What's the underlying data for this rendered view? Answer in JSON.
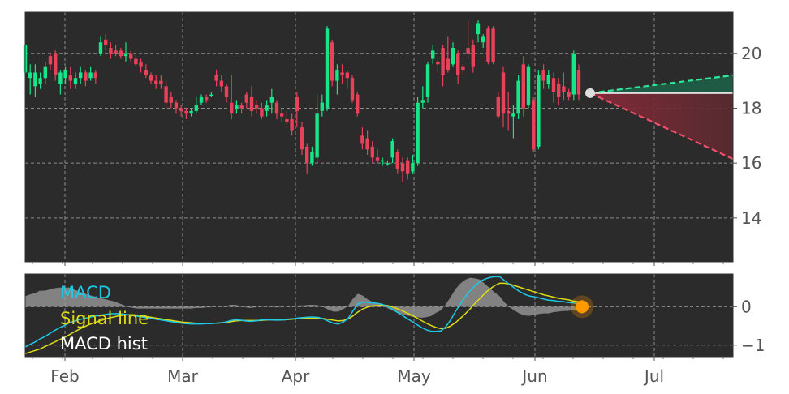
{
  "chart_data": [
    {
      "type": "candlestick",
      "title": "",
      "ylim": [
        12.4,
        21.5
      ],
      "y_ticks": [
        14,
        16,
        18,
        20
      ],
      "grid": true,
      "x_ticks": [
        "Feb",
        "Mar",
        "Apr",
        "May",
        "Jun",
        "Jul"
      ],
      "candles": [
        [
          19.3,
          20.3,
          19.8,
          19.2
        ],
        [
          19.1,
          19.3,
          19.6,
          18.5
        ],
        [
          18.8,
          19.3,
          19.6,
          18.4
        ],
        [
          18.9,
          19.1,
          19.3,
          18.7
        ],
        [
          19.1,
          19.5,
          19.7,
          18.9
        ],
        [
          19.9,
          19.6,
          20.0,
          19.4
        ],
        [
          20.0,
          19.2,
          20.1,
          19.0
        ],
        [
          18.9,
          19.3,
          19.4,
          18.5
        ],
        [
          19.1,
          19.4,
          19.5,
          18.9
        ],
        [
          19.2,
          19.0,
          19.5,
          18.7
        ],
        [
          18.9,
          19.1,
          19.3,
          18.7
        ],
        [
          19.1,
          19.3,
          19.5,
          18.9
        ],
        [
          19.3,
          19.0,
          19.4,
          18.8
        ],
        [
          19.1,
          19.3,
          19.5,
          19.0
        ],
        [
          19.3,
          19.1,
          19.4,
          18.9
        ],
        [
          20.0,
          20.4,
          20.6,
          19.9
        ],
        [
          20.5,
          20.3,
          20.7,
          20.1
        ],
        [
          20.2,
          20.0,
          20.4,
          19.8
        ],
        [
          20.1,
          20.0,
          20.3,
          19.9
        ],
        [
          20.1,
          19.9,
          20.2,
          19.8
        ],
        [
          19.9,
          20.0,
          20.4,
          19.7
        ],
        [
          20.0,
          19.8,
          20.1,
          19.7
        ],
        [
          19.8,
          19.6,
          20.0,
          19.5
        ],
        [
          19.7,
          19.5,
          19.8,
          19.3
        ],
        [
          19.4,
          19.2,
          19.6,
          19.1
        ],
        [
          19.2,
          19.0,
          19.3,
          18.9
        ],
        [
          19.0,
          18.9,
          19.2,
          18.7
        ],
        [
          19.0,
          18.9,
          19.2,
          18.7
        ],
        [
          18.8,
          18.2,
          19.0,
          18.0
        ],
        [
          18.4,
          18.2,
          18.6,
          18.0
        ],
        [
          18.2,
          18.0,
          18.3,
          17.8
        ],
        [
          18.0,
          17.9,
          18.1,
          17.7
        ],
        [
          17.9,
          17.8,
          18.0,
          17.6
        ],
        [
          17.8,
          17.9,
          18.0,
          17.7
        ],
        [
          17.9,
          18.1,
          18.4,
          17.8
        ],
        [
          18.2,
          18.4,
          18.5,
          18.1
        ],
        [
          18.4,
          18.3,
          18.5,
          18.2
        ],
        [
          18.5,
          18.5,
          18.6,
          18.4
        ],
        [
          19.2,
          19.0,
          19.4,
          18.8
        ],
        [
          19.0,
          18.8,
          19.2,
          18.6
        ],
        [
          18.8,
          18.4,
          18.9,
          18.2
        ],
        [
          18.2,
          17.8,
          19.2,
          17.6
        ],
        [
          18.0,
          18.1,
          18.3,
          17.8
        ],
        [
          18.1,
          18.0,
          18.2,
          17.8
        ],
        [
          18.5,
          18.2,
          18.6,
          18.0
        ],
        [
          18.4,
          17.9,
          18.8,
          17.7
        ],
        [
          18.1,
          18.0,
          18.3,
          17.8
        ],
        [
          18.0,
          17.7,
          18.2,
          17.6
        ],
        [
          17.9,
          18.1,
          18.3,
          17.7
        ],
        [
          18.2,
          18.4,
          18.7,
          17.8
        ],
        [
          18.2,
          17.8,
          18.3,
          17.6
        ],
        [
          17.8,
          17.7,
          18.0,
          17.5
        ],
        [
          17.6,
          17.5,
          17.9,
          17.4
        ],
        [
          17.6,
          17.2,
          17.8,
          17.0
        ],
        [
          18.4,
          17.9,
          18.6,
          17.3
        ],
        [
          17.3,
          16.5,
          17.5,
          16.3
        ],
        [
          16.6,
          16.0,
          16.7,
          15.6
        ],
        [
          16.0,
          16.4,
          16.6,
          15.9
        ],
        [
          16.2,
          17.8,
          18.5,
          16.0
        ],
        [
          17.9,
          18.2,
          18.5,
          17.7
        ],
        [
          18.0,
          20.9,
          21.0,
          17.9
        ],
        [
          20.4,
          19.0,
          20.5,
          18.8
        ],
        [
          19.0,
          19.4,
          19.6,
          18.5
        ],
        [
          19.3,
          19.2,
          19.6,
          18.9
        ],
        [
          19.3,
          19.1,
          19.4,
          18.7
        ],
        [
          19.1,
          18.3,
          19.2,
          18.2
        ],
        [
          18.5,
          17.8,
          18.6,
          17.7
        ],
        [
          17.0,
          16.7,
          17.3,
          16.5
        ],
        [
          16.9,
          16.5,
          17.2,
          16.3
        ],
        [
          16.6,
          16.2,
          16.8,
          16.0
        ],
        [
          16.2,
          16.1,
          16.5,
          16.0
        ],
        [
          16.1,
          16.1,
          16.2,
          15.9
        ],
        [
          16.0,
          16.0,
          16.1,
          15.9
        ],
        [
          16.2,
          16.8,
          16.9,
          16.0
        ],
        [
          16.4,
          15.8,
          16.5,
          15.6
        ],
        [
          16.0,
          15.7,
          16.2,
          15.3
        ],
        [
          16.1,
          15.6,
          16.2,
          15.4
        ],
        [
          15.7,
          16.0,
          16.3,
          15.6
        ],
        [
          16.0,
          18.2,
          18.4,
          15.9
        ],
        [
          18.2,
          18.3,
          18.8,
          18.0
        ],
        [
          18.4,
          19.6,
          19.7,
          18.2
        ],
        [
          19.8,
          20.1,
          20.3,
          19.6
        ],
        [
          19.7,
          19.6,
          19.9,
          19.3
        ],
        [
          20.2,
          19.2,
          20.3,
          18.8
        ],
        [
          19.8,
          19.4,
          20.6,
          19.3
        ],
        [
          19.6,
          20.2,
          20.4,
          19.5
        ],
        [
          20.0,
          19.2,
          20.1,
          18.9
        ],
        [
          19.5,
          19.4,
          19.6,
          19.2
        ],
        [
          20.2,
          20.0,
          21.2,
          19.8
        ],
        [
          20.3,
          19.5,
          20.5,
          19.3
        ],
        [
          20.7,
          21.1,
          21.2,
          20.4
        ],
        [
          20.4,
          20.6,
          20.7,
          20.2
        ],
        [
          20.9,
          19.7,
          21.0,
          19.6
        ],
        [
          20.9,
          19.7,
          21.0,
          19.6
        ],
        [
          18.4,
          17.7,
          18.6,
          17.6
        ],
        [
          19.3,
          17.8,
          19.5,
          17.3
        ],
        [
          17.9,
          17.8,
          18.6,
          17.2
        ],
        [
          17.7,
          17.8,
          18.1,
          16.9
        ],
        [
          17.8,
          19.0,
          19.2,
          17.6
        ],
        [
          19.6,
          18.0,
          19.9,
          17.7
        ],
        [
          18.1,
          19.5,
          19.6,
          18.0
        ],
        [
          18.3,
          16.5,
          18.4,
          16.4
        ],
        [
          16.6,
          19.2,
          19.4,
          16.5
        ],
        [
          19.4,
          19.0,
          19.6,
          18.7
        ],
        [
          18.9,
          19.2,
          19.4,
          18.7
        ],
        [
          19.1,
          18.6,
          19.3,
          18.2
        ],
        [
          18.9,
          18.4,
          19.1,
          18.1
        ],
        [
          18.8,
          18.6,
          19.3,
          18.3
        ],
        [
          18.6,
          18.4,
          18.7,
          18.3
        ],
        [
          18.5,
          20.0,
          20.1,
          18.3
        ],
        [
          19.4,
          18.5,
          19.6,
          18.3
        ]
      ],
      "projection": {
        "last_value": 18.55,
        "upper_end": 19.2,
        "lower_end": 16.15
      }
    },
    {
      "type": "line",
      "title": "",
      "ylim": [
        -1.3,
        0.85
      ],
      "y_ticks": [
        -1,
        0
      ],
      "grid": true,
      "legend_placement": "top-left",
      "series": [
        {
          "name": "MACD",
          "color": "#1ec8e6",
          "values": [
            -1.05,
            -0.98,
            -0.92,
            -0.84,
            -0.78,
            -0.7,
            -0.62,
            -0.55,
            -0.49,
            -0.42,
            -0.38,
            -0.34,
            -0.31,
            -0.28,
            -0.25,
            -0.23,
            -0.21,
            -0.19,
            -0.18,
            -0.18,
            -0.19,
            -0.21,
            -0.23,
            -0.25,
            -0.27,
            -0.29,
            -0.31,
            -0.33,
            -0.35,
            -0.37,
            -0.39,
            -0.41,
            -0.43,
            -0.44,
            -0.45,
            -0.45,
            -0.45,
            -0.44,
            -0.44,
            -0.43,
            -0.42,
            -0.4,
            -0.36,
            -0.34,
            -0.35,
            -0.37,
            -0.38,
            -0.37,
            -0.35,
            -0.34,
            -0.34,
            -0.35,
            -0.35,
            -0.34,
            -0.32,
            -0.31,
            -0.29,
            -0.28,
            -0.27,
            -0.27,
            -0.28,
            -0.32,
            -0.38,
            -0.43,
            -0.45,
            -0.4,
            -0.31,
            -0.11,
            0.07,
            0.12,
            0.11,
            0.1,
            0.09,
            0.06,
            0.01,
            -0.06,
            -0.14,
            -0.22,
            -0.3,
            -0.38,
            -0.46,
            -0.54,
            -0.6,
            -0.64,
            -0.64,
            -0.63,
            -0.52,
            -0.34,
            -0.12,
            0.08,
            0.26,
            0.42,
            0.55,
            0.66,
            0.72,
            0.76,
            0.78,
            0.78,
            0.68,
            0.58,
            0.49,
            0.4,
            0.33,
            0.28,
            0.26,
            0.23,
            0.2,
            0.17,
            0.16,
            0.14,
            0.13,
            0.11,
            0.1,
            0.08,
            0.06
          ]
        },
        {
          "name": "Signal line",
          "color": "#dcdc14",
          "values": [
            -1.22,
            -1.18,
            -1.14,
            -1.1,
            -1.04,
            -0.98,
            -0.92,
            -0.86,
            -0.8,
            -0.73,
            -0.66,
            -0.59,
            -0.53,
            -0.47,
            -0.42,
            -0.38,
            -0.34,
            -0.3,
            -0.27,
            -0.24,
            -0.22,
            -0.21,
            -0.21,
            -0.22,
            -0.24,
            -0.26,
            -0.28,
            -0.3,
            -0.32,
            -0.34,
            -0.36,
            -0.38,
            -0.4,
            -0.41,
            -0.42,
            -0.43,
            -0.43,
            -0.43,
            -0.43,
            -0.43,
            -0.42,
            -0.41,
            -0.39,
            -0.37,
            -0.36,
            -0.36,
            -0.36,
            -0.36,
            -0.36,
            -0.35,
            -0.34,
            -0.34,
            -0.34,
            -0.34,
            -0.33,
            -0.32,
            -0.31,
            -0.3,
            -0.3,
            -0.3,
            -0.3,
            -0.31,
            -0.33,
            -0.35,
            -0.37,
            -0.36,
            -0.32,
            -0.24,
            -0.14,
            -0.06,
            -0.01,
            0.02,
            0.03,
            0.04,
            0.03,
            0.0,
            -0.05,
            -0.1,
            -0.16,
            -0.22,
            -0.29,
            -0.36,
            -0.43,
            -0.49,
            -0.54,
            -0.57,
            -0.56,
            -0.5,
            -0.41,
            -0.3,
            -0.18,
            -0.05,
            0.09,
            0.22,
            0.35,
            0.46,
            0.55,
            0.61,
            0.61,
            0.59,
            0.55,
            0.51,
            0.47,
            0.43,
            0.39,
            0.35,
            0.31,
            0.28,
            0.25,
            0.22,
            0.2,
            0.18,
            0.15,
            0.13,
            0.11
          ]
        },
        {
          "name": "MACD hist",
          "color": "#a0a0a0",
          "type": "area"
        }
      ],
      "end_marker": {
        "value": 0.0,
        "color": "#ff9900"
      }
    }
  ]
}
